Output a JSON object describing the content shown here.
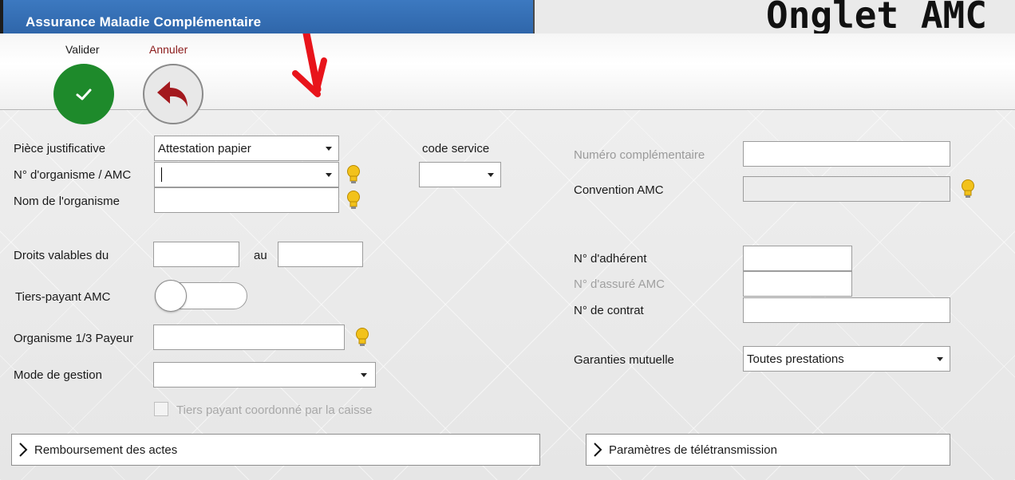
{
  "window": {
    "title": "Assurance Maladie Complémentaire"
  },
  "overlay": {
    "heading": "Onglet AMC"
  },
  "toolbar": {
    "valider_label": "Valider",
    "annuler_label": "Annuler"
  },
  "form": {
    "piece_label": "Pièce justificative",
    "piece_value": "Attestation papier",
    "code_service_label": "code service",
    "code_service_value": "",
    "organisme_label": "N° d'organisme / AMC",
    "organisme_value": "",
    "nom_organisme_label": "Nom de l'organisme",
    "nom_organisme_value": "",
    "droits_label": "Droits valables du",
    "au_label": "au",
    "droits_from": "",
    "droits_to": "",
    "tiers_payant_label": "Tiers-payant AMC",
    "tiers_payant_on": false,
    "organisme_payeur_label": "Organisme 1/3 Payeur",
    "organisme_payeur_value": "",
    "mode_gestion_label": "Mode de gestion",
    "mode_gestion_value": "",
    "tiers_coord_label": "Tiers payant coordonné par la caisse",
    "numero_compl_label": "Numéro complémentaire",
    "numero_compl_value": "",
    "convention_label": "Convention AMC",
    "convention_value": "",
    "adherent_label": "N° d'adhérent",
    "adherent_value": "",
    "assure_label": "N° d'assuré AMC",
    "assure_value": "",
    "contrat_label": "N° de contrat",
    "contrat_value": "",
    "garanties_label": "Garanties mutuelle",
    "garanties_value": "Toutes prestations"
  },
  "sections": {
    "remboursement": "Remboursement des actes",
    "teletransmission": "Paramètres de télétransmission"
  },
  "colors": {
    "titlebar": "#3373b8",
    "valider": "#1e8a2b",
    "annuler_arrow": "#a3191e",
    "annotation_arrow": "#e8141b",
    "bulb": "#f2c21b"
  }
}
